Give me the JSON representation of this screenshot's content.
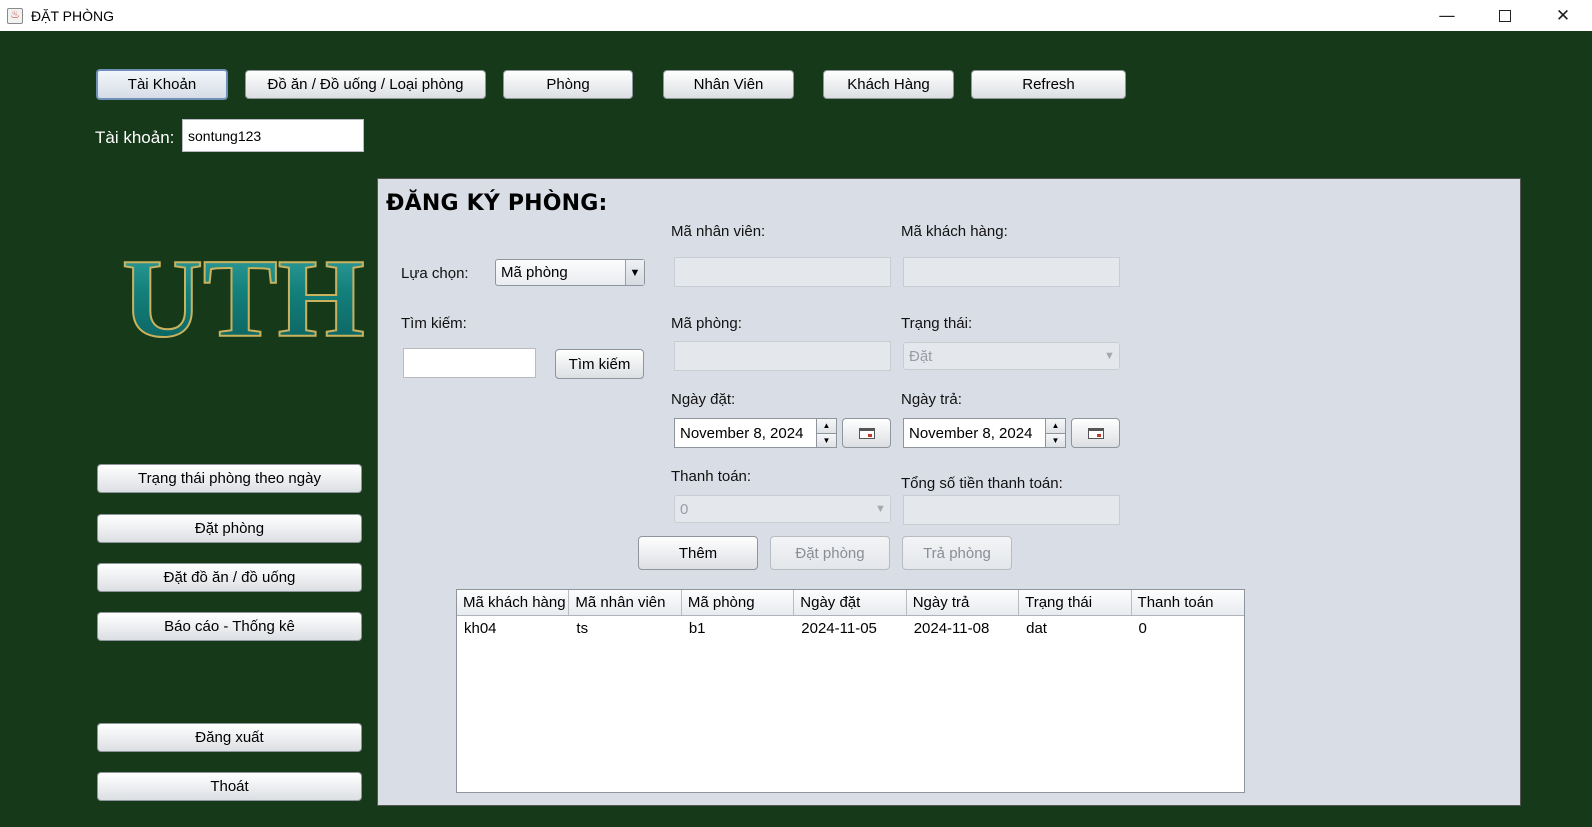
{
  "window": {
    "title": "ĐẶT PHÒNG",
    "controls": {
      "minimize": "—",
      "close": "✕"
    }
  },
  "topnav": {
    "items": [
      {
        "label": "Tài Khoản"
      },
      {
        "label": "Đồ ăn / Đồ uống / Loại phòng"
      },
      {
        "label": "Phòng"
      },
      {
        "label": "Nhân Viên"
      },
      {
        "label": "Khách Hàng"
      },
      {
        "label": "Refresh"
      }
    ]
  },
  "account": {
    "label": "Tài khoản:",
    "value": "sontung123"
  },
  "logo": {
    "text": "UTH"
  },
  "sidebar": {
    "items": [
      {
        "label": "Trạng thái phòng theo ngày"
      },
      {
        "label": "Đặt phòng"
      },
      {
        "label": "Đặt đồ ăn / đồ uống"
      },
      {
        "label": "Báo cáo - Thống kê"
      }
    ],
    "logout_label": "Đăng xuất",
    "exit_label": "Thoát"
  },
  "form": {
    "title": "ĐĂNG KÝ PHÒNG:",
    "choice_label": "Lựa chọn:",
    "choice_value": "Mã phòng",
    "search_label": "Tìm kiếm:",
    "search_value": "",
    "search_button": "Tìm kiếm",
    "employee_id_label": "Mã nhân viên:",
    "employee_id_value": "",
    "customer_id_label": "Mã khách hàng:",
    "customer_id_value": "",
    "room_id_label": "Mã phòng:",
    "room_id_value": "",
    "status_label": "Trạng thái:",
    "status_value": "Đặt",
    "booking_date_label": "Ngày đặt:",
    "booking_date_value": "November 8, 2024",
    "return_date_label": "Ngày trả:",
    "return_date_value": "November 8, 2024",
    "payment_label": "Thanh toán:",
    "payment_value": "0",
    "total_label": "Tổng số tiền thanh toán:",
    "total_value": "",
    "add_button": "Thêm",
    "book_button": "Đặt phòng",
    "return_button": "Trả phòng"
  },
  "table": {
    "columns": [
      "Mã khách hàng",
      "Mã nhân viên",
      "Mã phòng",
      "Ngày đặt",
      "Ngày trả",
      "Trạng thái",
      "Thanh toán"
    ],
    "rows": [
      [
        "kh04",
        "ts",
        "b1",
        "2024-11-05",
        "2024-11-08",
        "dat",
        "0"
      ]
    ]
  }
}
